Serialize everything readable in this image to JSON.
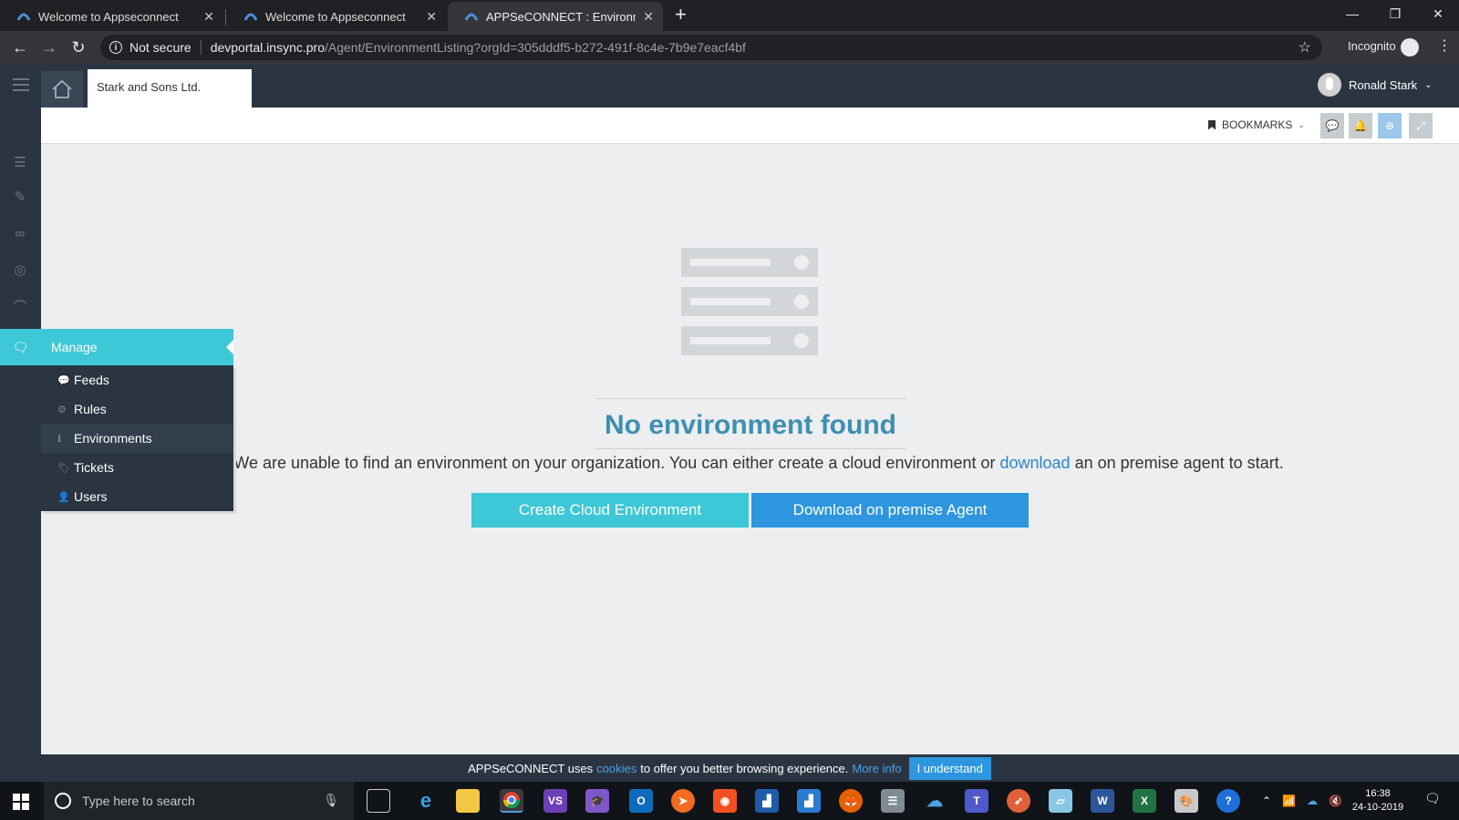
{
  "browser": {
    "tabs": [
      {
        "title": "Welcome to Appseconnect",
        "active": false
      },
      {
        "title": "Welcome to Appseconnect",
        "active": false
      },
      {
        "title": "APPSeCONNECT : Environments",
        "active": true
      }
    ],
    "address": {
      "security_label": "Not secure",
      "url_host": "devportal.insync.pro",
      "url_path": "/Agent/EnvironmentListing?orgId=305dddf5-b272-491f-8c4e-7b9e7eacf4bf"
    },
    "profile_label": "Incognito"
  },
  "header": {
    "org_name": "Stark and Sons Ltd.",
    "user_name": "Ronald Stark"
  },
  "topbar": {
    "bookmarks_label": "BOOKMARKS"
  },
  "manage_menu": {
    "title": "Manage",
    "items": [
      {
        "label": "Feeds",
        "icon": "comments-icon",
        "active": false
      },
      {
        "label": "Rules",
        "icon": "gear-icon",
        "active": false
      },
      {
        "label": "Environments",
        "icon": "info-icon",
        "active": true
      },
      {
        "label": "Tickets",
        "icon": "tag-icon",
        "active": false
      },
      {
        "label": "Users",
        "icon": "user-icon",
        "active": false
      }
    ]
  },
  "empty_state": {
    "title": "No environment found",
    "description_prefix": "We are unable to find an environment on your organization. You can either create a cloud environment or ",
    "description_link": "download",
    "description_suffix": " an on premise agent to start.",
    "create_button": "Create Cloud Environment",
    "download_button": "Download on premise Agent"
  },
  "cookie_bar": {
    "text_prefix": "APPSeCONNECT uses",
    "cookies_link": "cookies",
    "text_middle": "to offer you better browsing experience.",
    "more_info_link": "More info",
    "accept_button": "I understand"
  },
  "taskbar": {
    "search_placeholder": "Type here to search",
    "time": "16:38",
    "date": "24-10-2019"
  },
  "colors": {
    "accent_cyan": "#3ec7d6",
    "accent_blue": "#2d96de",
    "sidebar_dark": "#2b3542",
    "title_blue": "#3f8fb0"
  }
}
